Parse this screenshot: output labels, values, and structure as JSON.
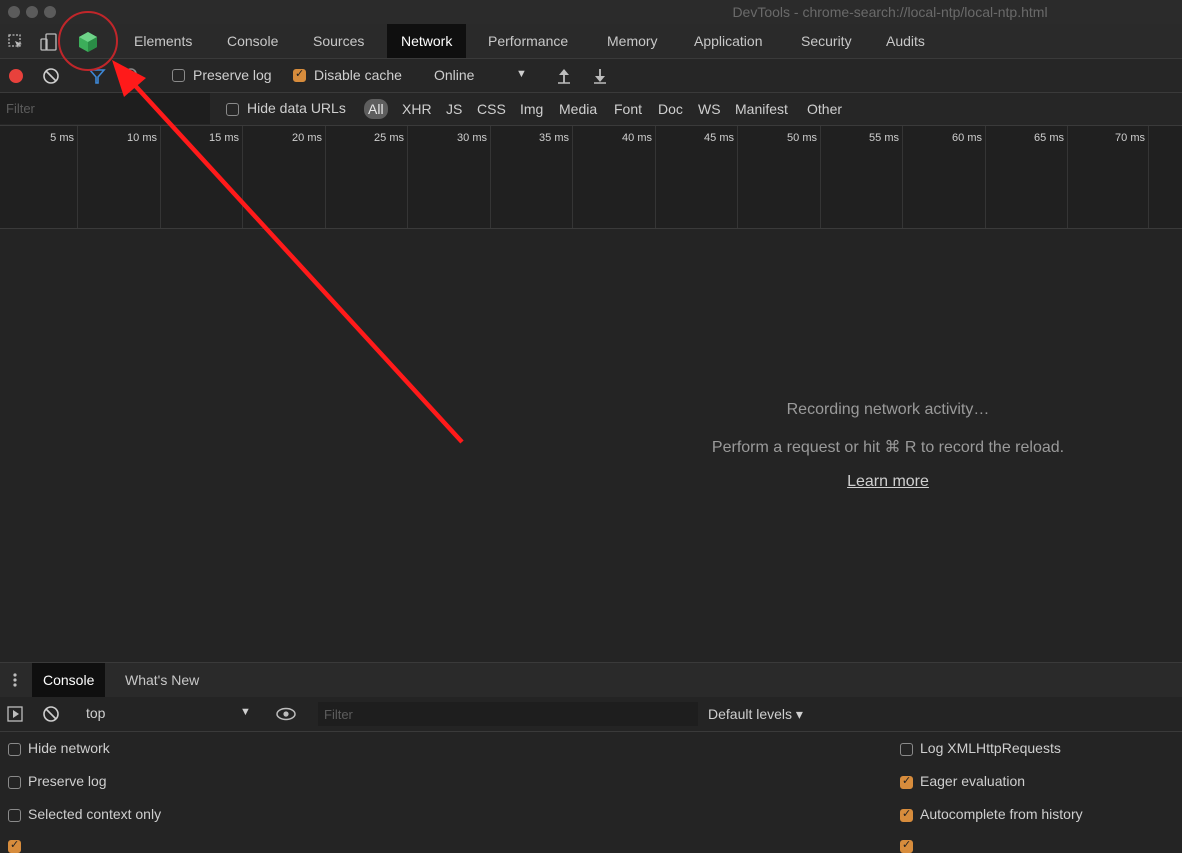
{
  "window": {
    "title": "DevTools - chrome-search://local-ntp/local-ntp.html"
  },
  "tabs": [
    {
      "label": "Elements"
    },
    {
      "label": "Console"
    },
    {
      "label": "Sources"
    },
    {
      "label": "Network",
      "active": true
    },
    {
      "label": "Performance"
    },
    {
      "label": "Memory"
    },
    {
      "label": "Application"
    },
    {
      "label": "Security"
    },
    {
      "label": "Audits"
    }
  ],
  "toolbar": {
    "preserve_log": {
      "label": "Preserve log",
      "checked": false
    },
    "disable_cache": {
      "label": "Disable cache",
      "checked": true
    },
    "throttling": {
      "value": "Online"
    }
  },
  "filterbar": {
    "placeholder": "Filter",
    "hide_data_urls": {
      "label": "Hide data URLs",
      "checked": false
    },
    "types": [
      "All",
      "XHR",
      "JS",
      "CSS",
      "Img",
      "Media",
      "Font",
      "Doc",
      "WS",
      "Manifest",
      "Other"
    ],
    "active_type": "All"
  },
  "timeline": {
    "ticks": [
      "5 ms",
      "10 ms",
      "15 ms",
      "20 ms",
      "25 ms",
      "30 ms",
      "35 ms",
      "40 ms",
      "45 ms",
      "50 ms",
      "55 ms",
      "60 ms",
      "65 ms",
      "70 ms"
    ]
  },
  "empty_state": {
    "line1": "Recording network activity…",
    "line2": "Perform a request or hit ⌘ R to record the reload.",
    "link": "Learn more"
  },
  "drawer": {
    "tabs": [
      {
        "label": "Console",
        "active": true
      },
      {
        "label": "What's New"
      }
    ],
    "context": "top",
    "filter_placeholder": "Filter",
    "levels": "Default levels ▾"
  },
  "console_settings": {
    "left": [
      {
        "label": "Hide network",
        "checked": false
      },
      {
        "label": "Preserve log",
        "checked": false
      },
      {
        "label": "Selected context only",
        "checked": false
      }
    ],
    "right": [
      {
        "label": "Log XMLHttpRequests",
        "checked": false
      },
      {
        "label": "Eager evaluation",
        "checked": true
      },
      {
        "label": "Autocomplete from history",
        "checked": true
      }
    ]
  },
  "colors": {
    "record": "#e8413c",
    "accent_checkbox": "#d78c3c",
    "annotation": "#ff1a1a",
    "extension_icon": "#3cae5a"
  },
  "icons": [
    "inspect-element-icon",
    "device-toolbar-icon",
    "extension-cube-icon",
    "record-icon",
    "clear-icon",
    "filter-icon",
    "search-icon",
    "import-har-icon",
    "export-har-icon",
    "drawer-menu-icon",
    "execute-context-icon",
    "clear-console-icon",
    "live-expression-eye-icon"
  ]
}
